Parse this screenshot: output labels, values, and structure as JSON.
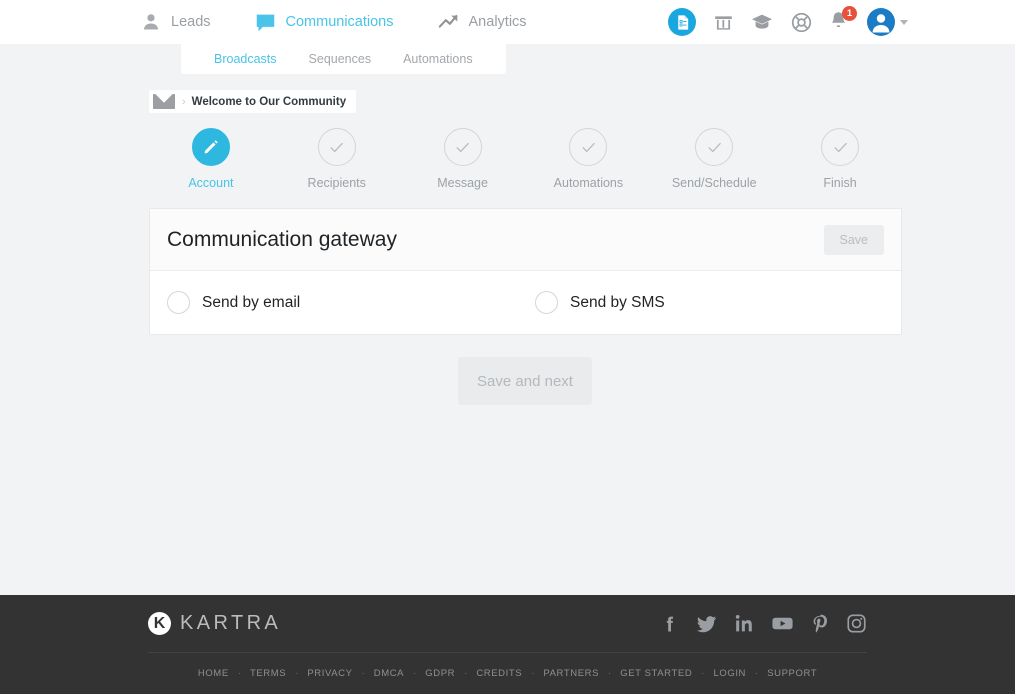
{
  "topnav": {
    "items": [
      {
        "label": "Leads",
        "icon": "person-icon",
        "active": false
      },
      {
        "label": "Communications",
        "icon": "speech-bubble-icon",
        "active": true
      },
      {
        "label": "Analytics",
        "icon": "trend-arrow-icon",
        "active": false
      }
    ],
    "right_icons": [
      {
        "name": "checklist-document-icon"
      },
      {
        "name": "storefront-icon"
      },
      {
        "name": "graduation-cap-icon"
      },
      {
        "name": "lifebuoy-help-icon"
      },
      {
        "name": "notification-bell-icon"
      }
    ],
    "notification_count": "1",
    "avatar_name": "user-avatar",
    "accent_color": "#49c4e8",
    "badge_color": "#e8503a"
  },
  "subtabs": [
    {
      "label": "Broadcasts",
      "active": true
    },
    {
      "label": "Sequences",
      "active": false
    },
    {
      "label": "Automations",
      "active": false
    }
  ],
  "breadcrumb": {
    "icon": "envelope-icon",
    "separator": "›",
    "title": "Welcome to Our Community"
  },
  "stepper": {
    "steps": [
      {
        "label": "Account",
        "state": "current",
        "icon": "pencil-icon"
      },
      {
        "label": "Recipients",
        "state": "pending",
        "icon": "check-icon"
      },
      {
        "label": "Message",
        "state": "pending",
        "icon": "check-icon"
      },
      {
        "label": "Automations",
        "state": "pending",
        "icon": "check-icon"
      },
      {
        "label": "Send/Schedule",
        "state": "pending",
        "icon": "check-icon"
      },
      {
        "label": "Finish",
        "state": "pending",
        "icon": "check-icon"
      }
    ]
  },
  "card": {
    "title": "Communication gateway",
    "save_label": "Save",
    "options": [
      {
        "label": "Send by email",
        "selected": false
      },
      {
        "label": "Send by SMS",
        "selected": false
      }
    ]
  },
  "actions": {
    "save_and_next_label": "Save and next"
  },
  "footer": {
    "logo_mark": "K",
    "logo_text": "KARTRA",
    "socials": [
      {
        "name": "facebook-icon"
      },
      {
        "name": "twitter-icon"
      },
      {
        "name": "linkedin-icon"
      },
      {
        "name": "youtube-icon"
      },
      {
        "name": "pinterest-icon"
      },
      {
        "name": "instagram-icon"
      }
    ],
    "links": [
      "HOME",
      "TERMS",
      "PRIVACY",
      "DMCA",
      "GDPR",
      "CREDITS",
      "PARTNERS",
      "GET STARTED",
      "LOGIN",
      "SUPPORT"
    ],
    "link_separator": "·",
    "background_color": "#333333"
  }
}
